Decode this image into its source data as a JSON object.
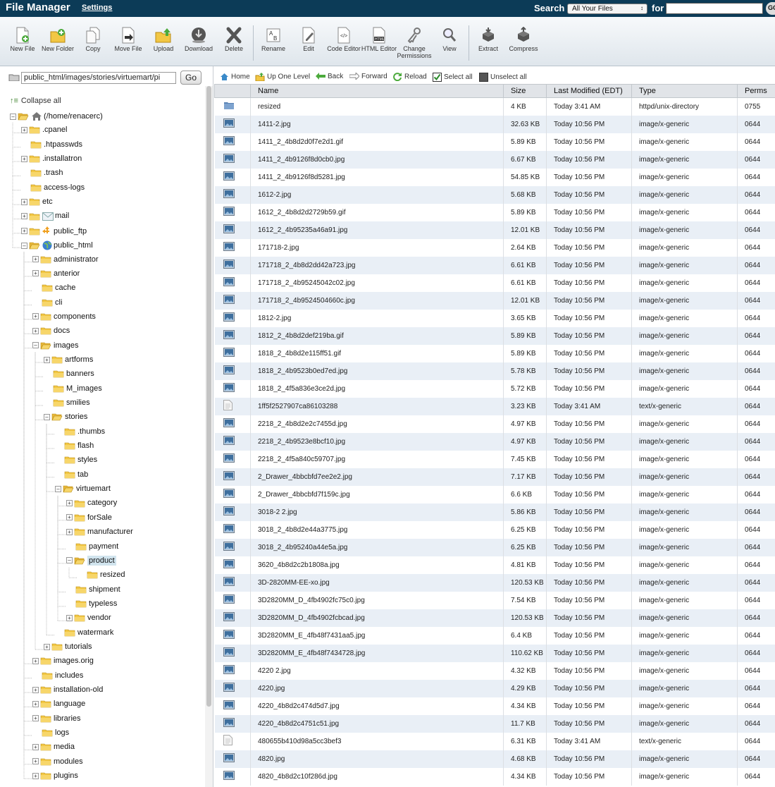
{
  "topbar": {
    "title": "File Manager",
    "settings": "Settings",
    "search_label": "Search",
    "search_scope": "All Your Files",
    "for_label": "for",
    "search_value": "",
    "go": "GO"
  },
  "toolbar": {
    "buttons": [
      {
        "id": "new-file",
        "label": "New File"
      },
      {
        "id": "new-folder",
        "label": "New Folder"
      },
      {
        "id": "copy",
        "label": "Copy"
      },
      {
        "id": "move-file",
        "label": "Move File"
      },
      {
        "id": "upload",
        "label": "Upload"
      },
      {
        "id": "download",
        "label": "Download"
      },
      {
        "id": "delete",
        "label": "Delete"
      },
      {
        "id": "rename",
        "label": "Rename"
      },
      {
        "id": "edit",
        "label": "Edit"
      },
      {
        "id": "code-editor",
        "label": "Code Editor"
      },
      {
        "id": "html-editor",
        "label": "HTML Editor"
      },
      {
        "id": "change-permissions",
        "label": "Change Permissions"
      },
      {
        "id": "view",
        "label": "View"
      },
      {
        "id": "extract",
        "label": "Extract"
      },
      {
        "id": "compress",
        "label": "Compress"
      }
    ]
  },
  "path_bar": {
    "value": "public_html/images/stories/virtuemart/pi",
    "go": "Go"
  },
  "tree": {
    "collapse_all": "Collapse all",
    "nodes": [
      {
        "label": "(/home/renacerc)",
        "depth": 0,
        "exp": "-",
        "icon": "home",
        "open": true
      },
      {
        "label": ".cpanel",
        "depth": 1,
        "exp": "+"
      },
      {
        "label": ".htpasswds",
        "depth": 1,
        "exp": ""
      },
      {
        "label": ".installatron",
        "depth": 1,
        "exp": "+"
      },
      {
        "label": ".trash",
        "depth": 1,
        "exp": ""
      },
      {
        "label": "access-logs",
        "depth": 1,
        "exp": ""
      },
      {
        "label": "etc",
        "depth": 1,
        "exp": "+"
      },
      {
        "label": "mail",
        "depth": 1,
        "exp": "+",
        "icon": "mail"
      },
      {
        "label": "public_ftp",
        "depth": 1,
        "exp": "+",
        "icon": "ftp"
      },
      {
        "label": "public_html",
        "depth": 1,
        "exp": "-",
        "icon": "globe",
        "open": true
      },
      {
        "label": "administrator",
        "depth": 2,
        "exp": "+"
      },
      {
        "label": "anterior",
        "depth": 2,
        "exp": "+"
      },
      {
        "label": "cache",
        "depth": 2,
        "exp": ""
      },
      {
        "label": "cli",
        "depth": 2,
        "exp": ""
      },
      {
        "label": "components",
        "depth": 2,
        "exp": "+"
      },
      {
        "label": "docs",
        "depth": 2,
        "exp": "+"
      },
      {
        "label": "images",
        "depth": 2,
        "exp": "-",
        "open": true
      },
      {
        "label": "artforms",
        "depth": 3,
        "exp": "+"
      },
      {
        "label": "banners",
        "depth": 3,
        "exp": ""
      },
      {
        "label": "M_images",
        "depth": 3,
        "exp": ""
      },
      {
        "label": "smilies",
        "depth": 3,
        "exp": ""
      },
      {
        "label": "stories",
        "depth": 3,
        "exp": "-",
        "open": true
      },
      {
        "label": ".thumbs",
        "depth": 4,
        "exp": ""
      },
      {
        "label": "flash",
        "depth": 4,
        "exp": ""
      },
      {
        "label": "styles",
        "depth": 4,
        "exp": ""
      },
      {
        "label": "tab",
        "depth": 4,
        "exp": ""
      },
      {
        "label": "virtuemart",
        "depth": 4,
        "exp": "-",
        "open": true
      },
      {
        "label": "category",
        "depth": 5,
        "exp": "+"
      },
      {
        "label": "forSale",
        "depth": 5,
        "exp": "+"
      },
      {
        "label": "manufacturer",
        "depth": 5,
        "exp": "+"
      },
      {
        "label": "payment",
        "depth": 5,
        "exp": ""
      },
      {
        "label": "product",
        "depth": 5,
        "exp": "-",
        "open": true,
        "selected": true
      },
      {
        "label": "resized",
        "depth": 6,
        "exp": ""
      },
      {
        "label": "shipment",
        "depth": 5,
        "exp": ""
      },
      {
        "label": "typeless",
        "depth": 5,
        "exp": ""
      },
      {
        "label": "vendor",
        "depth": 5,
        "exp": "+"
      },
      {
        "label": "watermark",
        "depth": 4,
        "exp": ""
      },
      {
        "label": "tutorials",
        "depth": 3,
        "exp": "+"
      },
      {
        "label": "images.orig",
        "depth": 2,
        "exp": "+"
      },
      {
        "label": "includes",
        "depth": 2,
        "exp": ""
      },
      {
        "label": "installation-old",
        "depth": 2,
        "exp": "+"
      },
      {
        "label": "language",
        "depth": 2,
        "exp": "+"
      },
      {
        "label": "libraries",
        "depth": 2,
        "exp": "+"
      },
      {
        "label": "logs",
        "depth": 2,
        "exp": ""
      },
      {
        "label": "media",
        "depth": 2,
        "exp": "+"
      },
      {
        "label": "modules",
        "depth": 2,
        "exp": "+"
      },
      {
        "label": "plugins",
        "depth": 2,
        "exp": "+"
      }
    ]
  },
  "nav": {
    "home": "Home",
    "up_one_level": "Up One Level",
    "back": "Back",
    "forward": "Forward",
    "reload": "Reload",
    "select_all": "Select all",
    "unselect_all": "Unselect all"
  },
  "table": {
    "headers": {
      "name": "Name",
      "size": "Size",
      "modified": "Last Modified (EDT)",
      "type": "Type",
      "perms": "Perms"
    },
    "rows": [
      [
        "folder",
        "resized",
        "4 KB",
        "Today 3:41 AM",
        "httpd/unix-directory",
        "0755"
      ],
      [
        "image",
        "1411-2.jpg",
        "32.63 KB",
        "Today 10:56 PM",
        "image/x-generic",
        "0644"
      ],
      [
        "image",
        "1411_2_4b8d2d0f7e2d1.gif",
        "5.89 KB",
        "Today 10:56 PM",
        "image/x-generic",
        "0644"
      ],
      [
        "image",
        "1411_2_4b9126f8d0cb0.jpg",
        "6.67 KB",
        "Today 10:56 PM",
        "image/x-generic",
        "0644"
      ],
      [
        "image",
        "1411_2_4b9126f8d5281.jpg",
        "54.85 KB",
        "Today 10:56 PM",
        "image/x-generic",
        "0644"
      ],
      [
        "image",
        "1612-2.jpg",
        "5.68 KB",
        "Today 10:56 PM",
        "image/x-generic",
        "0644"
      ],
      [
        "image",
        "1612_2_4b8d2d2729b59.gif",
        "5.89 KB",
        "Today 10:56 PM",
        "image/x-generic",
        "0644"
      ],
      [
        "image",
        "1612_2_4b95235a46a91.jpg",
        "12.01 KB",
        "Today 10:56 PM",
        "image/x-generic",
        "0644"
      ],
      [
        "image",
        "171718-2.jpg",
        "2.64 KB",
        "Today 10:56 PM",
        "image/x-generic",
        "0644"
      ],
      [
        "image",
        "171718_2_4b8d2dd42a723.jpg",
        "6.61 KB",
        "Today 10:56 PM",
        "image/x-generic",
        "0644"
      ],
      [
        "image",
        "171718_2_4b95245042c02.jpg",
        "6.61 KB",
        "Today 10:56 PM",
        "image/x-generic",
        "0644"
      ],
      [
        "image",
        "171718_2_4b9524504660c.jpg",
        "12.01 KB",
        "Today 10:56 PM",
        "image/x-generic",
        "0644"
      ],
      [
        "image",
        "1812-2.jpg",
        "3.65 KB",
        "Today 10:56 PM",
        "image/x-generic",
        "0644"
      ],
      [
        "image",
        "1812_2_4b8d2def219ba.gif",
        "5.89 KB",
        "Today 10:56 PM",
        "image/x-generic",
        "0644"
      ],
      [
        "image",
        "1818_2_4b8d2e115ff51.gif",
        "5.89 KB",
        "Today 10:56 PM",
        "image/x-generic",
        "0644"
      ],
      [
        "image",
        "1818_2_4b9523b0ed7ed.jpg",
        "5.78 KB",
        "Today 10:56 PM",
        "image/x-generic",
        "0644"
      ],
      [
        "image",
        "1818_2_4f5a836e3ce2d.jpg",
        "5.72 KB",
        "Today 10:56 PM",
        "image/x-generic",
        "0644"
      ],
      [
        "text",
        "1ff5f2527907ca86103288",
        "3.23 KB",
        "Today 3:41 AM",
        "text/x-generic",
        "0644"
      ],
      [
        "image",
        "2218_2_4b8d2e2c7455d.jpg",
        "4.97 KB",
        "Today 10:56 PM",
        "image/x-generic",
        "0644"
      ],
      [
        "image",
        "2218_2_4b9523e8bcf10.jpg",
        "4.97 KB",
        "Today 10:56 PM",
        "image/x-generic",
        "0644"
      ],
      [
        "image",
        "2218_2_4f5a840c59707.jpg",
        "7.45 KB",
        "Today 10:56 PM",
        "image/x-generic",
        "0644"
      ],
      [
        "image",
        "2_Drawer_4bbcbfd7ee2e2.jpg",
        "7.17 KB",
        "Today 10:56 PM",
        "image/x-generic",
        "0644"
      ],
      [
        "image",
        "2_Drawer_4bbcbfd7f159c.jpg",
        "6.6 KB",
        "Today 10:56 PM",
        "image/x-generic",
        "0644"
      ],
      [
        "image",
        "3018-2 2.jpg",
        "5.86 KB",
        "Today 10:56 PM",
        "image/x-generic",
        "0644"
      ],
      [
        "image",
        "3018_2_4b8d2e44a3775.jpg",
        "6.25 KB",
        "Today 10:56 PM",
        "image/x-generic",
        "0644"
      ],
      [
        "image",
        "3018_2_4b95240a44e5a.jpg",
        "6.25 KB",
        "Today 10:56 PM",
        "image/x-generic",
        "0644"
      ],
      [
        "image",
        "3620_4b8d2c2b1808a.jpg",
        "4.81 KB",
        "Today 10:56 PM",
        "image/x-generic",
        "0644"
      ],
      [
        "image",
        "3D-2820MM-EE-xo.jpg",
        "120.53 KB",
        "Today 10:56 PM",
        "image/x-generic",
        "0644"
      ],
      [
        "image",
        "3D2820MM_D_4fb4902fc75c0.jpg",
        "7.54 KB",
        "Today 10:56 PM",
        "image/x-generic",
        "0644"
      ],
      [
        "image",
        "3D2820MM_D_4fb4902fcbcad.jpg",
        "120.53 KB",
        "Today 10:56 PM",
        "image/x-generic",
        "0644"
      ],
      [
        "image",
        "3D2820MM_E_4fb48f7431aa5.jpg",
        "6.4 KB",
        "Today 10:56 PM",
        "image/x-generic",
        "0644"
      ],
      [
        "image",
        "3D2820MM_E_4fb48f7434728.jpg",
        "110.62 KB",
        "Today 10:56 PM",
        "image/x-generic",
        "0644"
      ],
      [
        "image",
        "4220 2.jpg",
        "4.32 KB",
        "Today 10:56 PM",
        "image/x-generic",
        "0644"
      ],
      [
        "image",
        "4220.jpg",
        "4.29 KB",
        "Today 10:56 PM",
        "image/x-generic",
        "0644"
      ],
      [
        "image",
        "4220_4b8d2c474d5d7.jpg",
        "4.34 KB",
        "Today 10:56 PM",
        "image/x-generic",
        "0644"
      ],
      [
        "image",
        "4220_4b8d2c4751c51.jpg",
        "11.7 KB",
        "Today 10:56 PM",
        "image/x-generic",
        "0644"
      ],
      [
        "text",
        "480655b410d98a5cc3bef3",
        "6.31 KB",
        "Today 3:41 AM",
        "text/x-generic",
        "0644"
      ],
      [
        "image",
        "4820.jpg",
        "4.68 KB",
        "Today 10:56 PM",
        "image/x-generic",
        "0644"
      ],
      [
        "image",
        "4820_4b8d2c10f286d.jpg",
        "4.34 KB",
        "Today 10:56 PM",
        "image/x-generic",
        "0644"
      ]
    ]
  }
}
